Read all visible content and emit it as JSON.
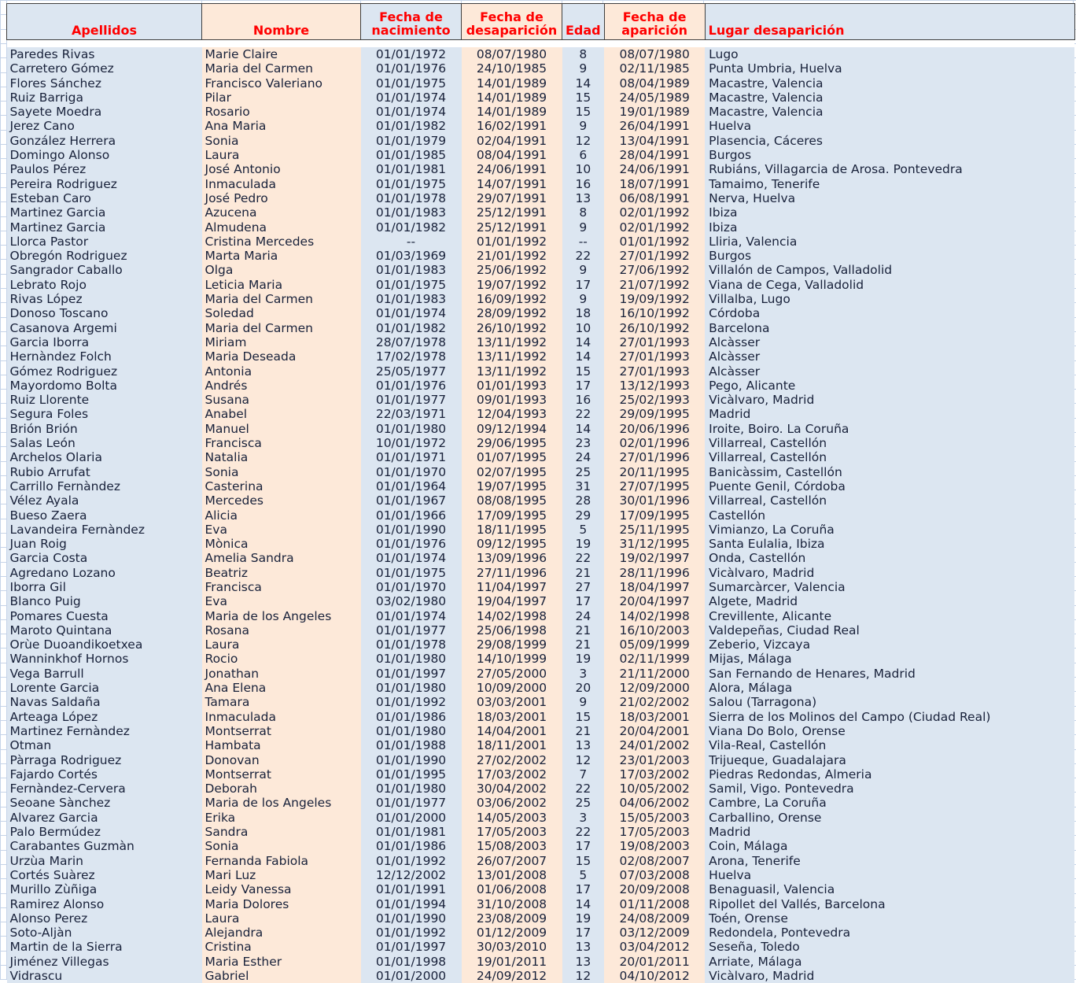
{
  "theme": {
    "header_text_color": "#ff0000",
    "col_blue": "#dce6f1",
    "col_peach": "#fde9d9",
    "body_text_color": "#18213a",
    "gridline_color": "#c5d3e8",
    "header_border_color": "#3f3f3f"
  },
  "table": {
    "columns": [
      {
        "key": "apellidos",
        "label": "Apellidos",
        "align": "center",
        "bg": "blue"
      },
      {
        "key": "nombre",
        "label": "Nombre",
        "align": "center",
        "bg": "peach"
      },
      {
        "key": "nacimiento",
        "label": "Fecha de nacimiento",
        "align": "center",
        "bg": "blue"
      },
      {
        "key": "desaparicion",
        "label": "Fecha de desaparición",
        "align": "center",
        "bg": "peach"
      },
      {
        "key": "edad",
        "label": "Edad",
        "align": "center",
        "bg": "blue"
      },
      {
        "key": "aparicion",
        "label": "Fecha de aparición",
        "align": "center",
        "bg": "peach"
      },
      {
        "key": "lugar",
        "label": "Lugar desaparición",
        "align": "left",
        "bg": "blue"
      }
    ],
    "row_count": 66,
    "rows": [
      [
        "Paredes Rivas",
        "Marie Claire",
        "01/01/1972",
        "08/07/1980",
        "8",
        "08/07/1980",
        "Lugo"
      ],
      [
        "Carretero Gómez",
        "Maria del Carmen",
        "01/01/1976",
        "24/10/1985",
        "9",
        "02/11/1985",
        "Punta Umbria, Huelva"
      ],
      [
        "Flores Sánchez",
        "Francisco Valeriano",
        "01/01/1975",
        "14/01/1989",
        "14",
        "08/04/1989",
        "Macastre, Valencia"
      ],
      [
        "Ruiz Barriga",
        "Pilar",
        "01/01/1974",
        "14/01/1989",
        "15",
        "24/05/1989",
        "Macastre, Valencia"
      ],
      [
        "Sayete Moedra",
        "Rosario",
        "01/01/1974",
        "14/01/1989",
        "15",
        "19/01/1989",
        "Macastre, Valencia"
      ],
      [
        "Jerez Cano",
        "Ana Maria",
        "01/01/1982",
        "16/02/1991",
        "9",
        "26/04/1991",
        "Huelva"
      ],
      [
        "González Herrera",
        "Sonia",
        "01/01/1979",
        "02/04/1991",
        "12",
        "13/04/1991",
        "Plasencia, Cáceres"
      ],
      [
        "Domingo Alonso",
        "Laura",
        "01/01/1985",
        "08/04/1991",
        "6",
        "28/04/1991",
        "Burgos"
      ],
      [
        "Paulos Pérez",
        "José Antonio",
        "01/01/1981",
        "24/06/1991",
        "10",
        "24/06/1991",
        "Rubiáns, Villagarcia de Arosa. Pontevedra"
      ],
      [
        "Pereira Rodriguez",
        "Inmaculada",
        "01/01/1975",
        "14/07/1991",
        "16",
        "18/07/1991",
        "Tamaimo, Tenerife"
      ],
      [
        "Esteban Caro",
        "José Pedro",
        "01/01/1978",
        "29/07/1991",
        "13",
        "06/08/1991",
        "Nerva, Huelva"
      ],
      [
        "Martinez Garcia",
        "Azucena",
        "01/01/1983",
        "25/12/1991",
        "8",
        "02/01/1992",
        "Ibiza"
      ],
      [
        "Martinez Garcia",
        "Almudena",
        "01/01/1982",
        "25/12/1991",
        "9",
        "02/01/1992",
        "Ibiza"
      ],
      [
        "Llorca Pastor",
        "Cristina Mercedes",
        "--",
        "01/01/1992",
        "--",
        "01/01/1992",
        "Lliria, Valencia"
      ],
      [
        "Obregón Rodriguez",
        "Marta Maria",
        "01/03/1969",
        "21/01/1992",
        "22",
        "27/01/1992",
        "Burgos"
      ],
      [
        "Sangrador Caballo",
        "Olga",
        "01/01/1983",
        "25/06/1992",
        "9",
        "27/06/1992",
        "Villalón de Campos, Valladolid"
      ],
      [
        "Lebrato Rojo",
        "Leticia Maria",
        "01/01/1975",
        "19/07/1992",
        "17",
        "21/07/1992",
        "Viana de Cega, Valladolid"
      ],
      [
        "Rivas López",
        "Maria del Carmen",
        "01/01/1983",
        "16/09/1992",
        "9",
        "19/09/1992",
        "Villalba, Lugo"
      ],
      [
        "Donoso Toscano",
        "Soledad",
        "01/01/1974",
        "28/09/1992",
        "18",
        "16/10/1992",
        "Córdoba"
      ],
      [
        "Casanova Argemi",
        "Maria del Carmen",
        "01/01/1982",
        "26/10/1992",
        "10",
        "26/10/1992",
        "Barcelona"
      ],
      [
        "Garcia Iborra",
        "Miriam",
        "28/07/1978",
        "13/11/1992",
        "14",
        "27/01/1993",
        "Alcàsser"
      ],
      [
        "Hernàndez Folch",
        "Maria Deseada",
        "17/02/1978",
        "13/11/1992",
        "14",
        "27/01/1993",
        "Alcàsser"
      ],
      [
        "Gómez Rodriguez",
        "Antonia",
        "25/05/1977",
        "13/11/1992",
        "15",
        "27/01/1993",
        "Alcàsser"
      ],
      [
        "Mayordomo Bolta",
        "Andrés",
        "01/01/1976",
        "01/01/1993",
        "17",
        "13/12/1993",
        "Pego, Alicante"
      ],
      [
        "Ruiz Llorente",
        "Susana",
        "01/01/1977",
        "09/01/1993",
        "16",
        "25/02/1993",
        "Vicàlvaro, Madrid"
      ],
      [
        "Segura Foles",
        "Anabel",
        "22/03/1971",
        "12/04/1993",
        "22",
        "29/09/1995",
        "Madrid"
      ],
      [
        "Brión Brión",
        "Manuel",
        "01/01/1980",
        "09/12/1994",
        "14",
        "20/06/1996",
        "Iroite, Boiro. La Coruña"
      ],
      [
        "Salas León",
        "Francisca",
        "10/01/1972",
        "29/06/1995",
        "23",
        "02/01/1996",
        "Villarreal, Castellón"
      ],
      [
        "Archelos Olaria",
        "Natalia",
        "01/01/1971",
        "01/07/1995",
        "24",
        "27/01/1996",
        "Villarreal, Castellón"
      ],
      [
        "Rubio Arrufat",
        "Sonia",
        "01/01/1970",
        "02/07/1995",
        "25",
        "20/11/1995",
        "Banicàssim, Castellón"
      ],
      [
        "Carrillo Fernàndez",
        "Casterina",
        "01/01/1964",
        "19/07/1995",
        "31",
        "27/07/1995",
        "Puente Genil, Córdoba"
      ],
      [
        "Vélez Ayala",
        "Mercedes",
        "01/01/1967",
        "08/08/1995",
        "28",
        "30/01/1996",
        "Villarreal, Castellón"
      ],
      [
        "Bueso Zaera",
        "Alicia",
        "01/01/1966",
        "17/09/1995",
        "29",
        "17/09/1995",
        "Castellón"
      ],
      [
        "Lavandeira Fernàndez",
        "Eva",
        "01/01/1990",
        "18/11/1995",
        "5",
        "25/11/1995",
        "Vimianzo, La Coruña"
      ],
      [
        "Juan Roig",
        "Mònica",
        "01/01/1976",
        "09/12/1995",
        "19",
        "31/12/1995",
        "Santa Eulalia, Ibiza"
      ],
      [
        "Garcia Costa",
        "Amelia Sandra",
        "01/01/1974",
        "13/09/1996",
        "22",
        "19/02/1997",
        "Onda, Castellón"
      ],
      [
        "Agredano Lozano",
        "Beatriz",
        "01/01/1975",
        "27/11/1996",
        "21",
        "28/11/1996",
        "Vicàlvaro, Madrid"
      ],
      [
        "Iborra Gil",
        "Francisca",
        "01/01/1970",
        "11/04/1997",
        "27",
        "18/04/1997",
        "Sumarcàrcer, Valencia"
      ],
      [
        "Blanco Puig",
        "Eva",
        "03/02/1980",
        "19/04/1997",
        "17",
        "20/04/1997",
        "Algete, Madrid"
      ],
      [
        "Pomares Cuesta",
        "Maria de los Angeles",
        "01/01/1974",
        "14/02/1998",
        "24",
        "14/02/1998",
        "Crevillente, Alicante"
      ],
      [
        "Maroto Quintana",
        "Rosana",
        "01/01/1977",
        "25/06/1998",
        "21",
        "16/10/2003",
        "Valdepeñas, Ciudad Real"
      ],
      [
        "Orùe Duoandikoetxea",
        "Laura",
        "01/01/1978",
        "29/08/1999",
        "21",
        "05/09/1999",
        "Zeberio, Vizcaya"
      ],
      [
        "Wanninkhof Hornos",
        "Rocio",
        "01/01/1980",
        "14/10/1999",
        "19",
        "02/11/1999",
        "Mijas, Málaga"
      ],
      [
        "Vega Barrull",
        "Jonathan",
        "01/01/1997",
        "27/05/2000",
        "3",
        "21/11/2000",
        "San Fernando de Henares, Madrid"
      ],
      [
        "Lorente Garcia",
        "Ana Elena",
        "01/01/1980",
        "10/09/2000",
        "20",
        "12/09/2000",
        "Alora, Málaga"
      ],
      [
        "Navas Saldaña",
        "Tamara",
        "01/01/1992",
        "03/03/2001",
        "9",
        "21/02/2002",
        "Salou (Tarragona)"
      ],
      [
        "Arteaga López",
        "Inmaculada",
        "01/01/1986",
        "18/03/2001",
        "15",
        "18/03/2001",
        "Sierra de los Molinos del Campo (Ciudad Real)"
      ],
      [
        "Martinez Fernàndez",
        "Montserrat",
        "01/01/1980",
        "14/04/2001",
        "21",
        "20/04/2001",
        "Viana Do Bolo, Orense"
      ],
      [
        "Otman",
        "Hambata",
        "01/01/1988",
        "18/11/2001",
        "13",
        "24/01/2002",
        "Vila-Real, Castellón"
      ],
      [
        "Pàrraga Rodriguez",
        "Donovan",
        "01/01/1990",
        "27/02/2002",
        "12",
        "23/01/2003",
        "Trijueque, Guadalajara"
      ],
      [
        "Fajardo Cortés",
        "Montserrat",
        "01/01/1995",
        "17/03/2002",
        "7",
        "17/03/2002",
        "Piedras Redondas, Almeria"
      ],
      [
        "Fernàndez-Cervera",
        "Deborah",
        "01/01/1980",
        "30/04/2002",
        "22",
        "10/05/2002",
        "Samil, Vigo. Pontevedra"
      ],
      [
        "Seoane Sànchez",
        "Maria de los Angeles",
        "01/01/1977",
        "03/06/2002",
        "25",
        "04/06/2002",
        "Cambre, La Coruña"
      ],
      [
        "Alvarez Garcia",
        "Erika",
        "01/01/2000",
        "14/05/2003",
        "3",
        "15/05/2003",
        "Carballino, Orense"
      ],
      [
        "Palo Bermúdez",
        "Sandra",
        "01/01/1981",
        "17/05/2003",
        "22",
        "17/05/2003",
        "Madrid"
      ],
      [
        "Carabantes Guzmàn",
        "Sonia",
        "01/01/1986",
        "15/08/2003",
        "17",
        "19/08/2003",
        "Coin, Málaga"
      ],
      [
        "Urzùa Marin",
        "Fernanda Fabiola",
        "01/01/1992",
        "26/07/2007",
        "15",
        "02/08/2007",
        "Arona, Tenerife"
      ],
      [
        "Cortés Suàrez",
        "Mari Luz",
        "12/12/2002",
        "13/01/2008",
        "5",
        "07/03/2008",
        "Huelva"
      ],
      [
        "Murillo Zùñiga",
        "Leidy Vanessa",
        "01/01/1991",
        "01/06/2008",
        "17",
        "20/09/2008",
        "Benaguasil, Valencia"
      ],
      [
        "Ramirez Alonso",
        "Maria Dolores",
        "01/01/1994",
        "31/10/2008",
        "14",
        "01/11/2008",
        "Ripollet del Vallés, Barcelona"
      ],
      [
        "Alonso Perez",
        "Laura",
        "01/01/1990",
        "23/08/2009",
        "19",
        "24/08/2009",
        "Toén, Orense"
      ],
      [
        "Soto-Aljàn",
        "Alejandra",
        "01/01/1992",
        "01/12/2009",
        "17",
        "03/12/2009",
        "Redondela, Pontevedra"
      ],
      [
        "Martin de la Sierra",
        "Cristina",
        "01/01/1997",
        "30/03/2010",
        "13",
        "03/04/2012",
        "Seseña, Toledo"
      ],
      [
        "Jiménez Villegas",
        "Maria Esther",
        "01/01/1998",
        "19/01/2011",
        "13",
        "20/01/2011",
        "Arriate, Málaga"
      ],
      [
        "Vidrascu",
        "Gabriel",
        "01/01/2000",
        "24/09/2012",
        "12",
        "04/10/2012",
        "Vicàlvaro, Madrid"
      ]
    ]
  }
}
